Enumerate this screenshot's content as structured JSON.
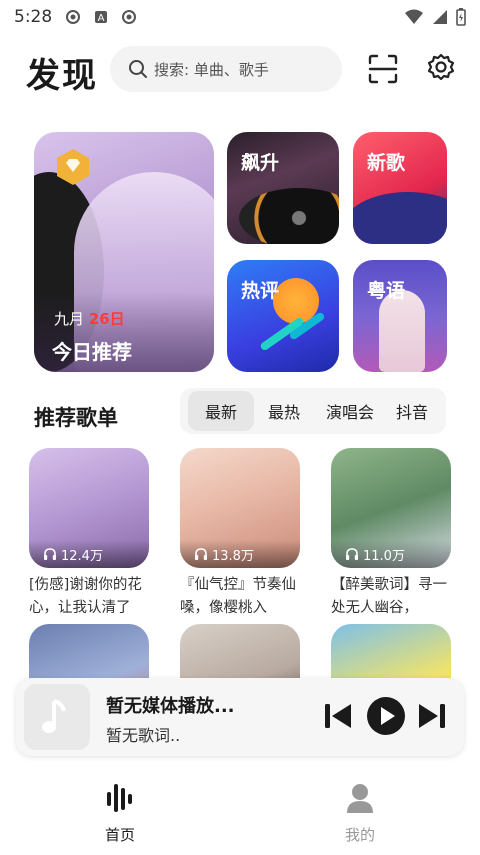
{
  "status_bar": {
    "time": "5:28"
  },
  "header": {
    "title": "发现",
    "search_placeholder": "搜索: 单曲、歌手"
  },
  "featured": {
    "date_month": "九月",
    "date_day": "26日",
    "label": "今日推荐"
  },
  "tiles": [
    {
      "label": "飙升"
    },
    {
      "label": "新歌"
    },
    {
      "label": "热评"
    },
    {
      "label": "粤语"
    }
  ],
  "playlists_section": {
    "title": "推荐歌单",
    "tabs": [
      "最新",
      "最热",
      "演唱会",
      "抖音"
    ],
    "active_tab": "最新"
  },
  "playlists": [
    {
      "count": "12.4万",
      "name": "[伤感]谢谢你的花心，让我认清了"
    },
    {
      "count": "13.8万",
      "name": "『仙气控』节奏仙嗓，像樱桃入"
    },
    {
      "count": "11.0万",
      "name": "【醉美歌词】寻一处无人幽谷，"
    },
    {
      "count": "",
      "name": ""
    },
    {
      "count": "",
      "name": ""
    },
    {
      "count": "",
      "name": ""
    }
  ],
  "player": {
    "title": "暂无媒体播放...",
    "lyric": "暂无歌词.."
  },
  "nav": {
    "home": "首页",
    "mine": "我的"
  },
  "colors": {
    "accent_day": "#ff3b3b",
    "text": "#1a1a1a",
    "inactive_nav": "#999999"
  }
}
